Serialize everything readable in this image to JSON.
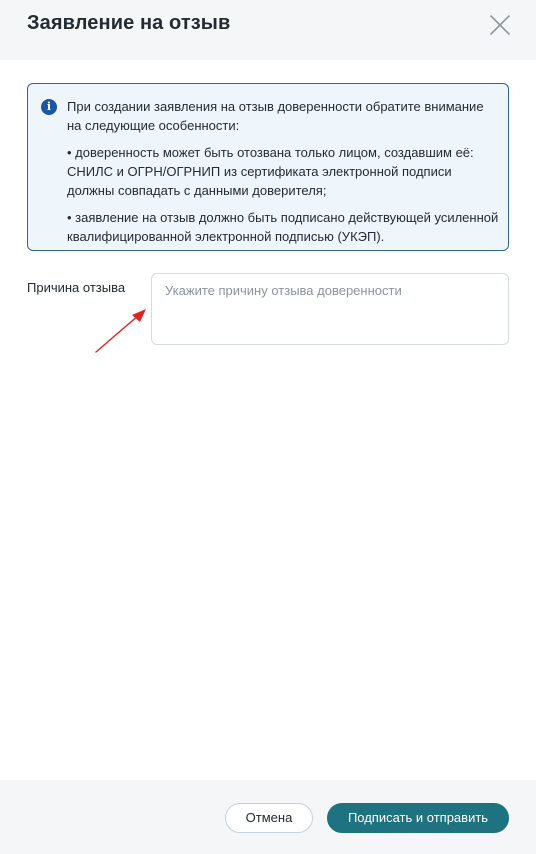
{
  "dialog": {
    "title": "Заявление на отзыв"
  },
  "info": {
    "paragraph_1": "При создании заявления на отзыв доверенности обратите внимание на следующие особенности:",
    "paragraph_2": "• доверенность может быть отозвана только лицом, создавшим её: СНИЛС и ОГРН/ОГРНИП из сертификата электронной подписи должны совпадать с данными доверителя;",
    "paragraph_3": "• заявление на отзыв должно быть подписано действующей усиленной квалифицированной электронной подписью (УКЭП).",
    "icon": "info-icon"
  },
  "form": {
    "reason_label": "Причина отзыва",
    "reason_value": "",
    "reason_placeholder": "Укажите причину отзыва доверенности"
  },
  "footer": {
    "cancel_label": "Отмена",
    "submit_label": "Подписать и отправить"
  },
  "colors": {
    "accent": "#1f7280",
    "info_border": "#2b6b86",
    "info_background": "#eef6fb",
    "info_icon": "#1b57a7",
    "annotation_arrow": "#e02424"
  }
}
